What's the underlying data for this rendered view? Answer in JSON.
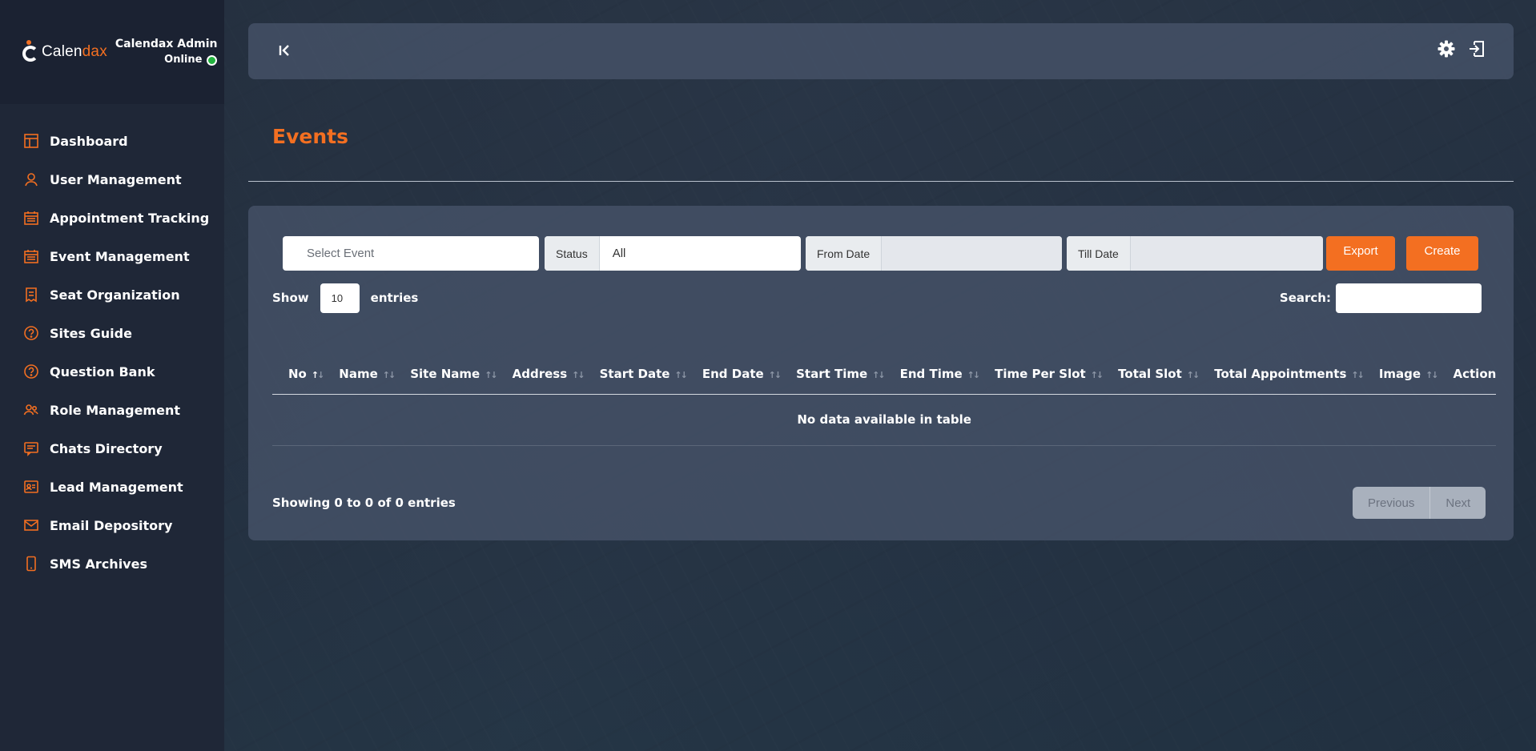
{
  "brand": {
    "logo_main": "Calen",
    "logo_accent": "dax",
    "admin_name": "Calendax Admin",
    "admin_status": "Online"
  },
  "sidebar": {
    "items": [
      {
        "label": "Dashboard",
        "icon": "dashboard-icon"
      },
      {
        "label": "User Management",
        "icon": "user-icon"
      },
      {
        "label": "Appointment Tracking",
        "icon": "calendar-icon"
      },
      {
        "label": "Event Management",
        "icon": "calendar-icon"
      },
      {
        "label": "Seat Organization",
        "icon": "receipt-icon"
      },
      {
        "label": "Sites Guide",
        "icon": "help-circle-icon"
      },
      {
        "label": "Question Bank",
        "icon": "help-circle-icon"
      },
      {
        "label": "Role Management",
        "icon": "users-icon"
      },
      {
        "label": "Chats Directory",
        "icon": "chat-icon"
      },
      {
        "label": "Lead Management",
        "icon": "lead-icon"
      },
      {
        "label": "Email Depository",
        "icon": "mail-icon"
      },
      {
        "label": "SMS Archives",
        "icon": "phone-icon"
      }
    ]
  },
  "page": {
    "title": "Events"
  },
  "filters": {
    "select_event_placeholder": "Select Event",
    "status_label": "Status",
    "status_value": "All",
    "from_label": "From Date",
    "till_label": "Till Date",
    "export_label": "Export",
    "create_label": "Create"
  },
  "table": {
    "show_label": "Show",
    "entries_value": "10",
    "entries_label": "entries",
    "search_label": "Search:",
    "columns": [
      "No",
      "Name",
      "Site Name",
      "Address",
      "Start Date",
      "End Date",
      "Start Time",
      "End Time",
      "Time Per Slot",
      "Total Slot",
      "Total Appointments",
      "Image",
      "Action"
    ],
    "empty_message": "No data available in table",
    "info": "Showing 0 to 0 of 0 entries",
    "prev_label": "Previous",
    "next_label": "Next"
  },
  "colors": {
    "accent": "#f36f21",
    "sidebar": "#1f2737",
    "online": "#23b33f"
  }
}
